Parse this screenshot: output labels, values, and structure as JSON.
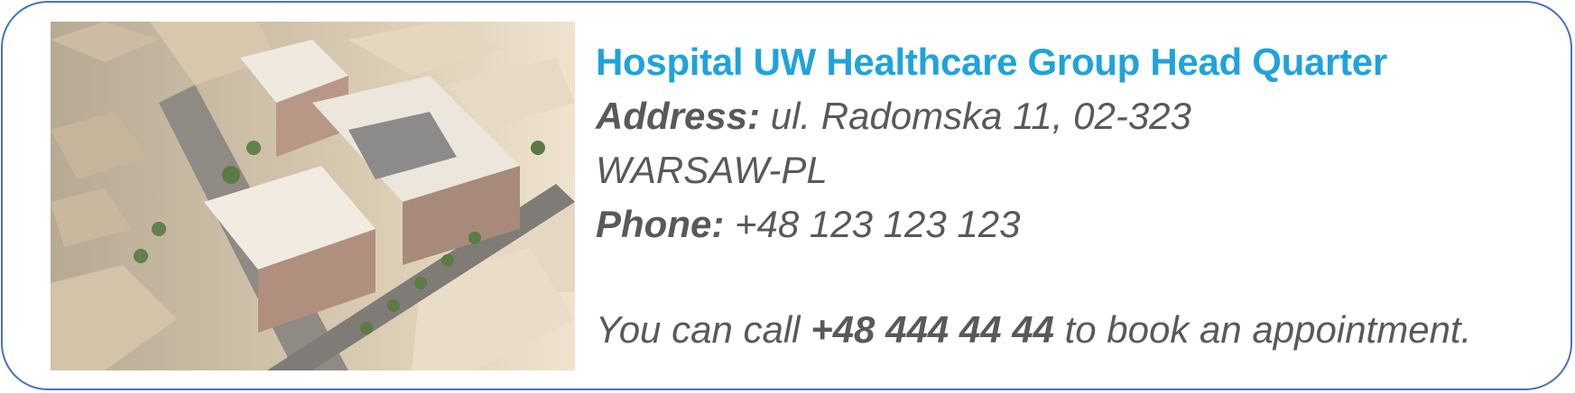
{
  "colors": {
    "title": "#1fa3dc",
    "text": "#595959",
    "border": "#4a70c0"
  },
  "photo": {
    "alt": "hospital-aerial-rendering"
  },
  "hospital": {
    "title": "Hospital UW Healthcare Group Head Quarter",
    "address_label": "Address:",
    "address_line1": " ul. Radomska 11, 02-323",
    "address_line2": "WARSAW-PL",
    "phone_label": "Phone:",
    "phone_value": " +48 123 123 123",
    "call_prefix": "You can call ",
    "call_number": "+48 444 44 44",
    "call_suffix": " to book an appointment."
  }
}
